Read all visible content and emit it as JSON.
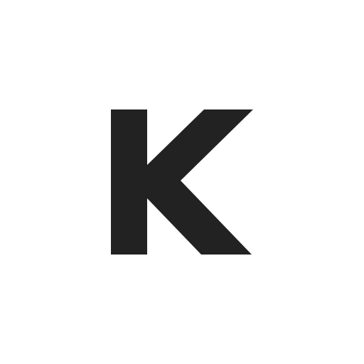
{
  "logo": {
    "letter": "K",
    "color": "#222222",
    "background": "#ffffff"
  }
}
